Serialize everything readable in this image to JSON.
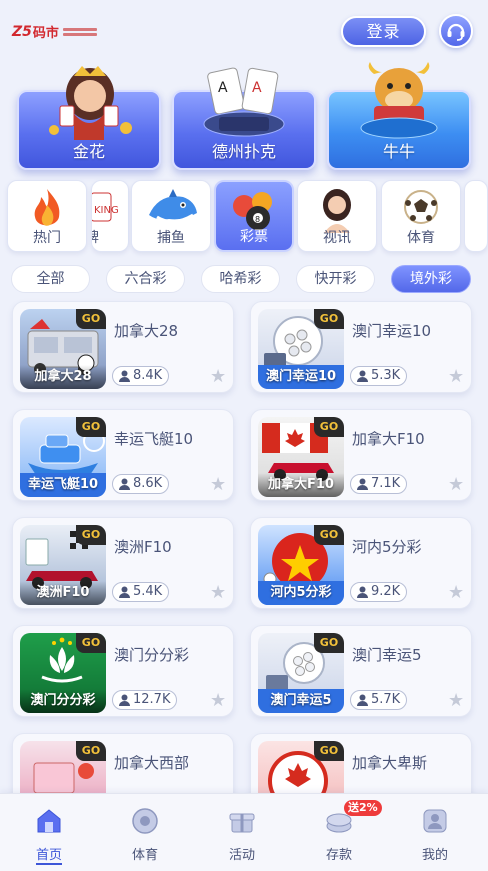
{
  "header": {
    "logo_text": "码市",
    "login_label": "登录"
  },
  "hero_games": [
    {
      "label": "金花"
    },
    {
      "label": "德州扑克"
    },
    {
      "label": "牛牛"
    }
  ],
  "categories": [
    {
      "label": "热门",
      "icon": "flame-icon"
    },
    {
      "label": "牌",
      "icon": "cards-icon"
    },
    {
      "label": "捕鱼",
      "icon": "shark-icon"
    },
    {
      "label": "彩票",
      "icon": "lottery-balls-icon",
      "active": true
    },
    {
      "label": "视讯",
      "icon": "live-dealer-icon"
    },
    {
      "label": "体育",
      "icon": "soccer-ball-icon"
    }
  ],
  "lottery_tabs": [
    {
      "label": "全部"
    },
    {
      "label": "六合彩"
    },
    {
      "label": "哈希彩"
    },
    {
      "label": "快开彩"
    },
    {
      "label": "境外彩",
      "active": true
    }
  ],
  "badge_label": "GO",
  "games": [
    {
      "name": "加拿大28",
      "caption": "加拿大28",
      "players": "8.4K"
    },
    {
      "name": "澳门幸运10",
      "caption": "澳门幸运10",
      "players": "5.3K"
    },
    {
      "name": "幸运飞艇10",
      "caption": "幸运飞艇10",
      "players": "8.6K"
    },
    {
      "name": "加拿大F10",
      "caption": "加拿大F10",
      "players": "7.1K"
    },
    {
      "name": "澳洲F10",
      "caption": "澳洲F10",
      "players": "5.4K"
    },
    {
      "name": "河内5分彩",
      "caption": "河内5分彩",
      "players": "9.2K"
    },
    {
      "name": "澳门分分彩",
      "caption": "澳门分分彩",
      "players": "12.7K"
    },
    {
      "name": "澳门幸运5",
      "caption": "澳门幸运5",
      "players": "5.7K"
    },
    {
      "name": "加拿大西部",
      "caption": "",
      "players": ""
    },
    {
      "name": "加拿大卑斯",
      "caption": "",
      "players": ""
    }
  ],
  "bottom_nav": [
    {
      "label": "首页",
      "icon": "home-icon",
      "active": true
    },
    {
      "label": "体育",
      "icon": "sports-icon"
    },
    {
      "label": "活动",
      "icon": "gift-icon"
    },
    {
      "label": "存款",
      "icon": "deposit-icon",
      "badge": "送2%"
    },
    {
      "label": "我的",
      "icon": "profile-icon"
    }
  ],
  "colors": {
    "accent": "#5a6ff0",
    "background": "#eef1fb",
    "text": "#4a5478",
    "badge_red": "#ee3b3b"
  }
}
